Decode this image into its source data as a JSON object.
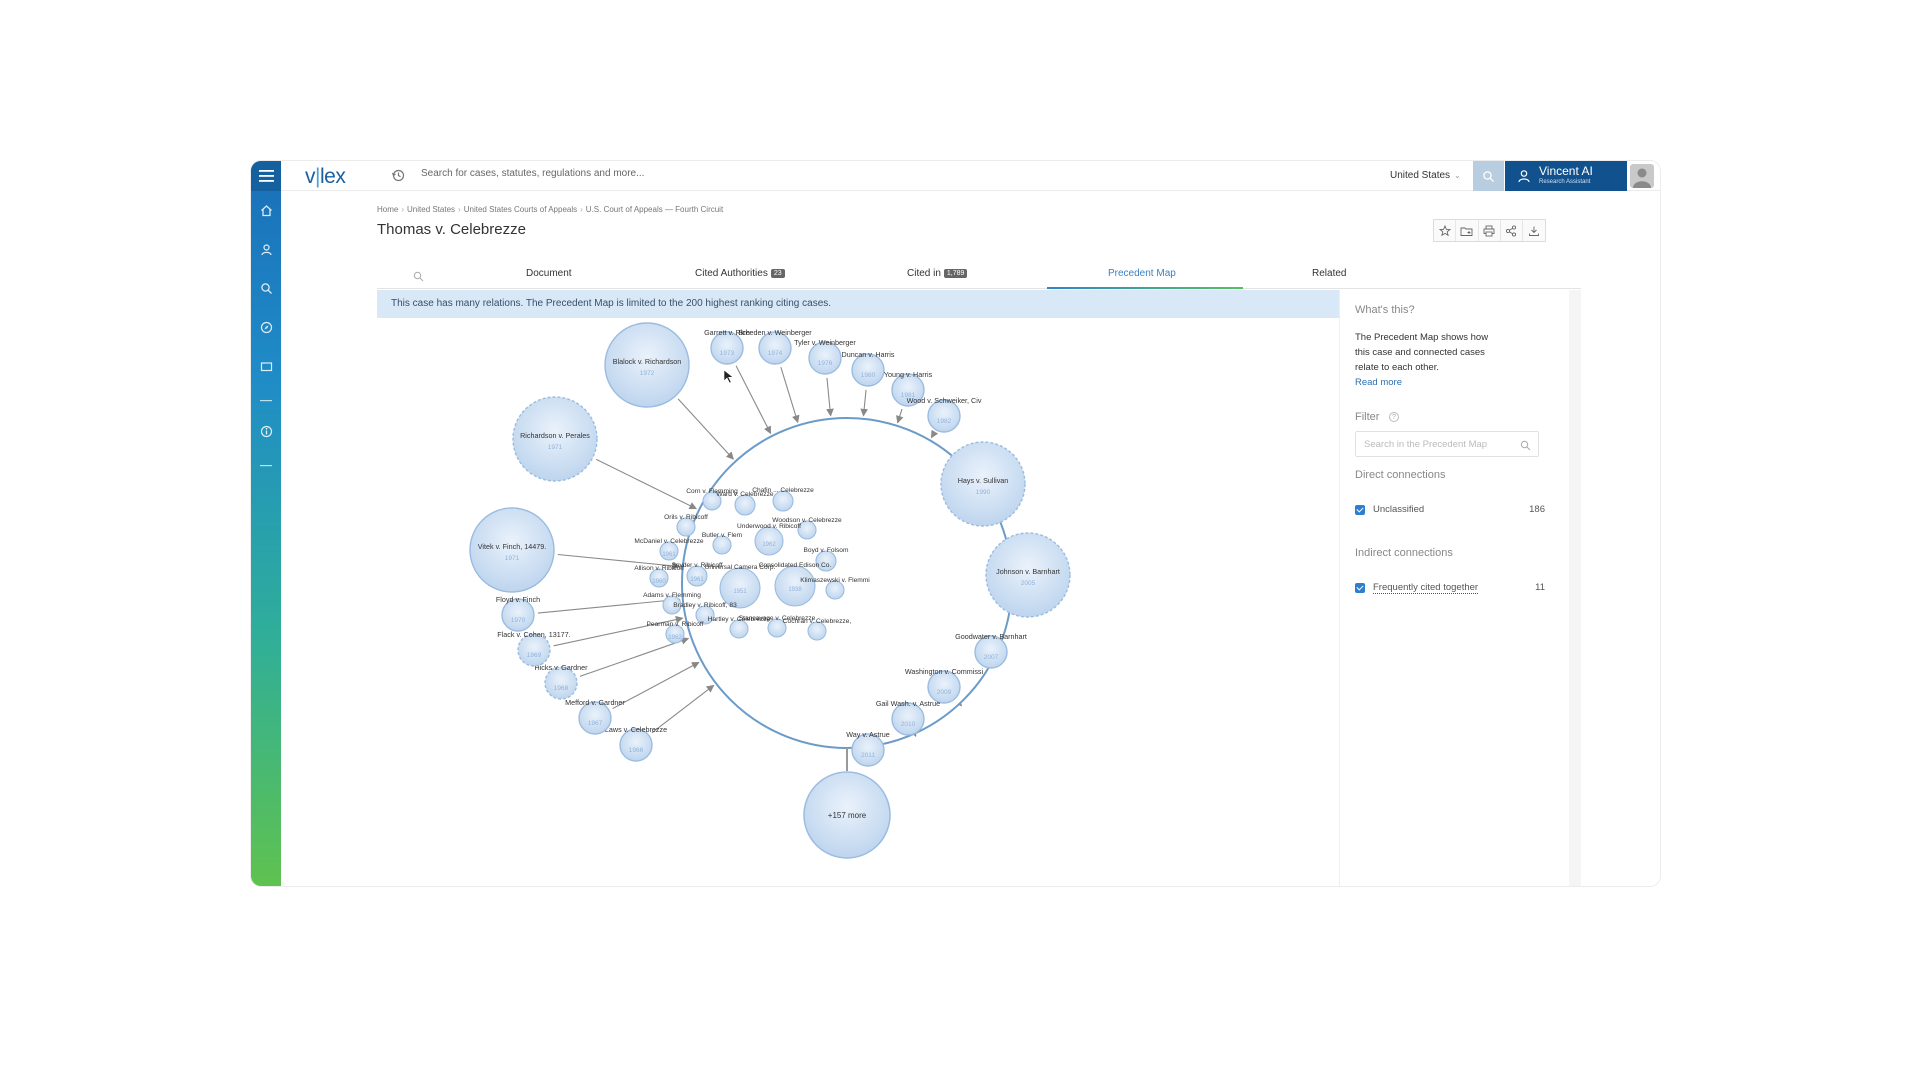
{
  "app": {
    "logo_main": "v",
    "logo_bar": "|",
    "logo_rest": "lex"
  },
  "topbar": {
    "search_placeholder": "Search for cases, statutes, regulations and more...",
    "jurisdiction": "United States",
    "assistant_name": "Vincent AI",
    "assistant_sub": "Research Assistant"
  },
  "breadcrumb": [
    "Home",
    "United States",
    "United States Courts of Appeals",
    "U.S. Court of Appeals — Fourth Circuit"
  ],
  "page_title": "Thomas v. Celebrezze",
  "tabs": [
    {
      "label": "Document",
      "badge": ""
    },
    {
      "label": "Cited Authorities",
      "badge": "23"
    },
    {
      "label": "Cited in",
      "badge": "1,789"
    },
    {
      "label": "Precedent Map",
      "badge": ""
    },
    {
      "label": "Related",
      "badge": ""
    }
  ],
  "notice": "This case has many relations. The Precedent Map is limited to the 200 highest ranking citing cases.",
  "map": {
    "more_label": "+157 more",
    "outer_nodes": [
      {
        "label": "Blalock v. Richardson",
        "year": "1972"
      },
      {
        "label": "Garrett v. Rich",
        "year": "1973"
      },
      {
        "label": "Breeden v. Weinberger",
        "year": "1974"
      },
      {
        "label": "Tyler v. Weinberger",
        "year": "1976"
      },
      {
        "label": "Duncan v. Harris",
        "year": "1980"
      },
      {
        "label": "Young v. Harris",
        "year": "1981"
      },
      {
        "label": "Wood v. Schweiker, Civ",
        "year": "1982"
      },
      {
        "label": "Hays v. Sullivan",
        "year": "1990"
      },
      {
        "label": "Johnson v. Barnhart",
        "year": "2005"
      },
      {
        "label": "Goodwater v. Barnhart",
        "year": "2007"
      },
      {
        "label": "Washington v. Commissi",
        "year": "2009"
      },
      {
        "label": "Gail Wash. v. Astrue",
        "year": "2010"
      },
      {
        "label": "Way v. Astrue",
        "year": "2011"
      },
      {
        "label": "Laws v. Celebrezze",
        "year": "1966"
      },
      {
        "label": "Mefford v. Gardner",
        "year": "1967"
      },
      {
        "label": "Hicks v. Gardner",
        "year": "1968"
      },
      {
        "label": "Flack v. Cohen, 13177.",
        "year": "1969"
      },
      {
        "label": "Floyd v. Finch",
        "year": "1970"
      },
      {
        "label": "Vitek v. Finch, 14479.",
        "year": "1971"
      },
      {
        "label": "Richardson v. Perales",
        "year": "1971"
      }
    ],
    "inner_nodes": [
      {
        "label": "Corn v. Flemming",
        "year": ""
      },
      {
        "label": "Ward v. Celebrezze",
        "year": ""
      },
      {
        "label": "Chafin ... Celebrezze",
        "year": ""
      },
      {
        "label": "Orils v. Ribicoff",
        "year": ""
      },
      {
        "label": "Woodson v. Celebrezze",
        "year": ""
      },
      {
        "label": "Butler v. Flem",
        "year": ""
      },
      {
        "label": "Underwood v. Ribicoff",
        "year": "1962"
      },
      {
        "label": "McDaniel v. Celebrezze",
        "year": "1961"
      },
      {
        "label": "Boyd v. Folsom",
        "year": ""
      },
      {
        "label": "Allison v. Ribicoff",
        "year": "1960"
      },
      {
        "label": "Snyder v. Ribicoff",
        "year": "1961"
      },
      {
        "label": "Universal Camera Corp.",
        "year": "1951"
      },
      {
        "label": "Consolidated Edison Co.",
        "year": "1938"
      },
      {
        "label": "Klimaszewski v. Flemmi",
        "year": ""
      },
      {
        "label": "Adams v. Flemming",
        "year": ""
      },
      {
        "label": "Bradley v. Ribicoff, 83",
        "year": ""
      },
      {
        "label": "Pearman v. Ribicoff",
        "year": "1962"
      },
      {
        "label": "Hartley v. Celebrezze",
        "year": ""
      },
      {
        "label": "Stancavage v. Celebrezze",
        "year": ""
      },
      {
        "label": "Cochran v. Celebrezze,",
        "year": ""
      }
    ]
  },
  "side": {
    "what_title": "What's this?",
    "what_body": "The Precedent Map shows how this case and connected cases relate to each other.",
    "read_more": "Read more",
    "filter_title": "Filter",
    "filter_help": "?",
    "filter_placeholder": "Search in the Precedent Map",
    "direct_title": "Direct connections",
    "direct_items": [
      {
        "label": "Unclassified",
        "count": "186"
      }
    ],
    "indirect_title": "Indirect connections",
    "indirect_items": [
      {
        "label": "Frequently cited together",
        "count": "11"
      }
    ]
  },
  "colors": {
    "brand": "#11518d",
    "accent": "#3b7fc4",
    "node_fill": "#cfe0f3",
    "node_stroke": "#9bbce0",
    "center_stroke": "#6b9bc8"
  }
}
